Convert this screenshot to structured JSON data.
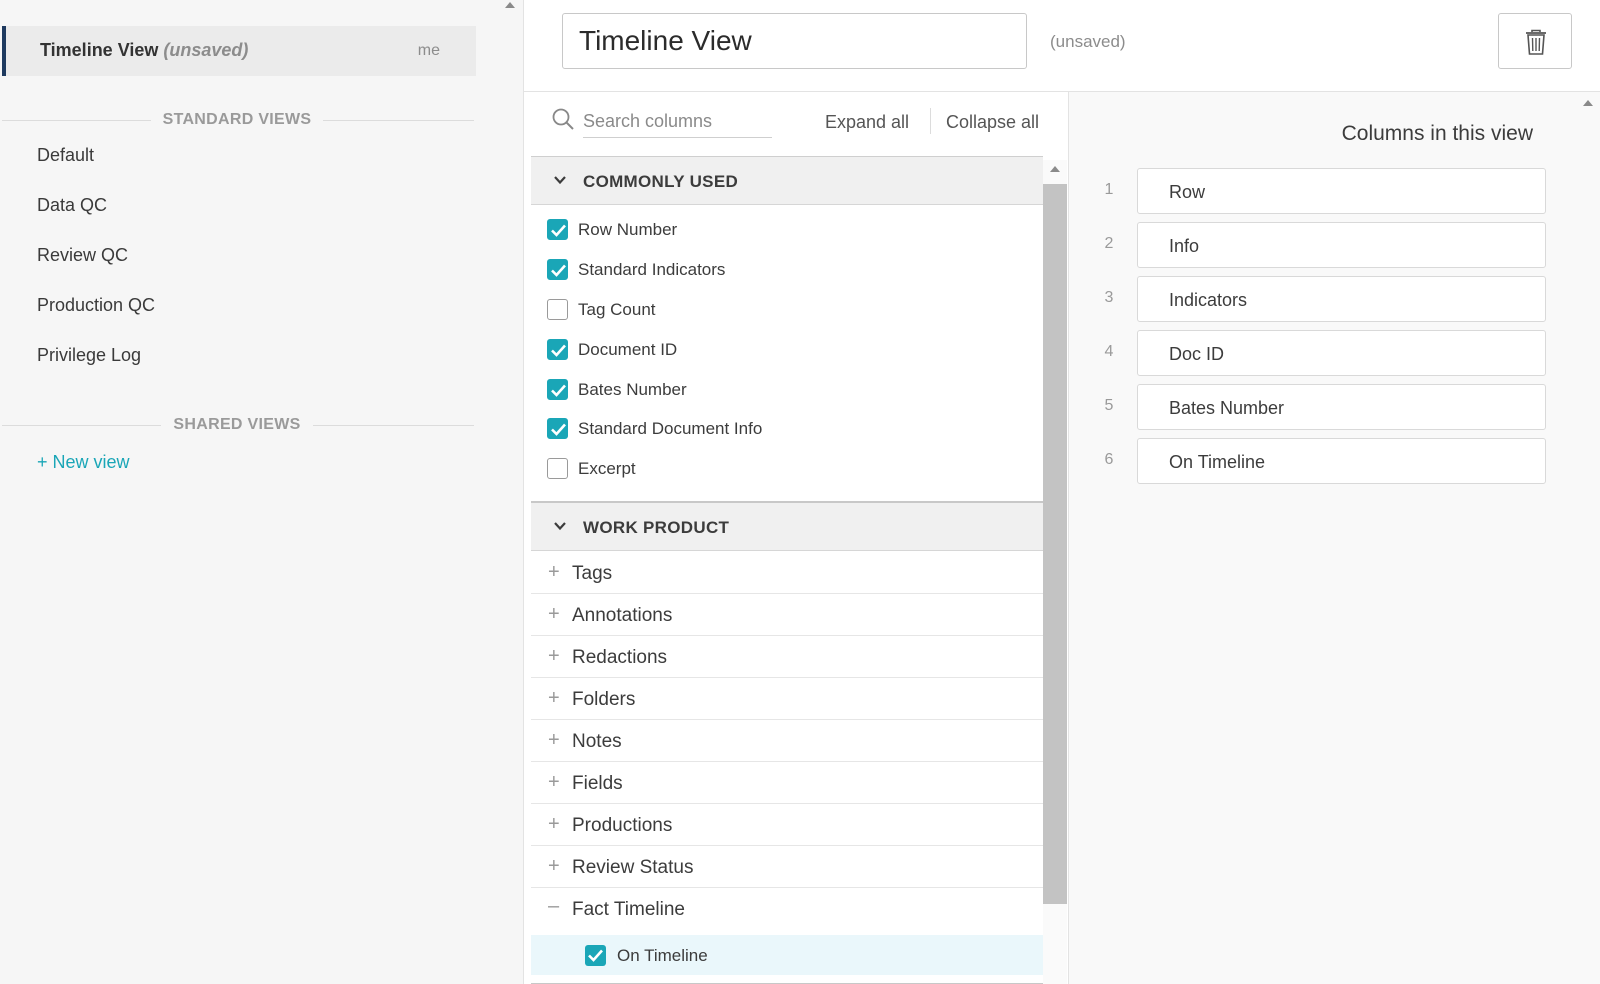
{
  "sidebar": {
    "active_view": {
      "name": "Timeline View",
      "status": "(unsaved)",
      "owner": "me"
    },
    "standard_views_heading": "STANDARD VIEWS",
    "standard_views": [
      "Default",
      "Data QC",
      "Review QC",
      "Production QC",
      "Privilege Log"
    ],
    "shared_views_heading": "SHARED VIEWS",
    "new_view_label": "+ New view"
  },
  "header": {
    "view_name_value": "Timeline View",
    "unsaved_label": "(unsaved)",
    "delete_icon": "trash-icon"
  },
  "column_picker": {
    "search_placeholder": "Search columns",
    "expand_all": "Expand all",
    "collapse_all": "Collapse all",
    "commonly_used": {
      "title": "COMMONLY USED",
      "items": [
        {
          "label": "Row Number",
          "checked": true
        },
        {
          "label": "Standard Indicators",
          "checked": true
        },
        {
          "label": "Tag Count",
          "checked": false
        },
        {
          "label": "Document ID",
          "checked": true
        },
        {
          "label": "Bates Number",
          "checked": true
        },
        {
          "label": "Standard Document Info",
          "checked": true
        },
        {
          "label": "Excerpt",
          "checked": false
        }
      ]
    },
    "work_product": {
      "title": "WORK PRODUCT",
      "items": [
        {
          "label": "Tags",
          "expanded": false
        },
        {
          "label": "Annotations",
          "expanded": false
        },
        {
          "label": "Redactions",
          "expanded": false
        },
        {
          "label": "Folders",
          "expanded": false
        },
        {
          "label": "Notes",
          "expanded": false
        },
        {
          "label": "Fields",
          "expanded": false
        },
        {
          "label": "Productions",
          "expanded": false
        },
        {
          "label": "Review Status",
          "expanded": false
        },
        {
          "label": "Fact Timeline",
          "expanded": true
        }
      ],
      "fact_timeline_children": [
        {
          "label": "On Timeline",
          "checked": true
        }
      ]
    }
  },
  "selected_columns": {
    "title": "Columns in this view",
    "items": [
      {
        "number": "1",
        "label": "Row"
      },
      {
        "number": "2",
        "label": "Info"
      },
      {
        "number": "3",
        "label": "Indicators"
      },
      {
        "number": "4",
        "label": "Doc ID"
      },
      {
        "number": "5",
        "label": "Bates Number"
      },
      {
        "number": "6",
        "label": "On Timeline"
      }
    ]
  },
  "colors": {
    "accent": "#1aa6b7",
    "active_marker": "#1e3a5f"
  }
}
